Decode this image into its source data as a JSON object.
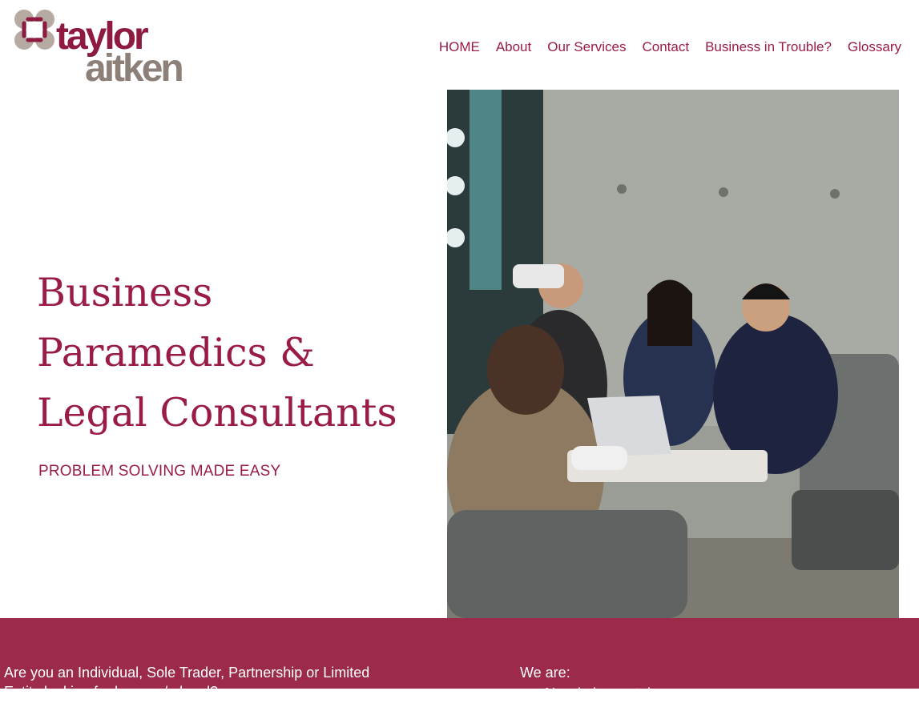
{
  "brand": {
    "name_line1": "taylor",
    "name_line2": "aitken",
    "color_primary": "#9a1b46",
    "color_secondary": "#8c8078"
  },
  "nav": {
    "items": [
      {
        "label": "HOME"
      },
      {
        "label": "About"
      },
      {
        "label": "Our Services"
      },
      {
        "label": "Contact"
      },
      {
        "label": "Business in Trouble?"
      },
      {
        "label": "Glossary"
      }
    ]
  },
  "hero": {
    "title_lines": [
      "Business",
      "Paramedics &",
      "Legal Consultants"
    ],
    "subtitle": "PROBLEM SOLVING MADE EASY"
  },
  "band": {
    "color": "#9b2a4b",
    "left_text": "Are you an Individual, Sole Trader, Partnership or Limited Entity looking for lawyers/a legal?",
    "right_label": "We are:",
    "right_items": [
      "No win leam stake"
    ]
  }
}
